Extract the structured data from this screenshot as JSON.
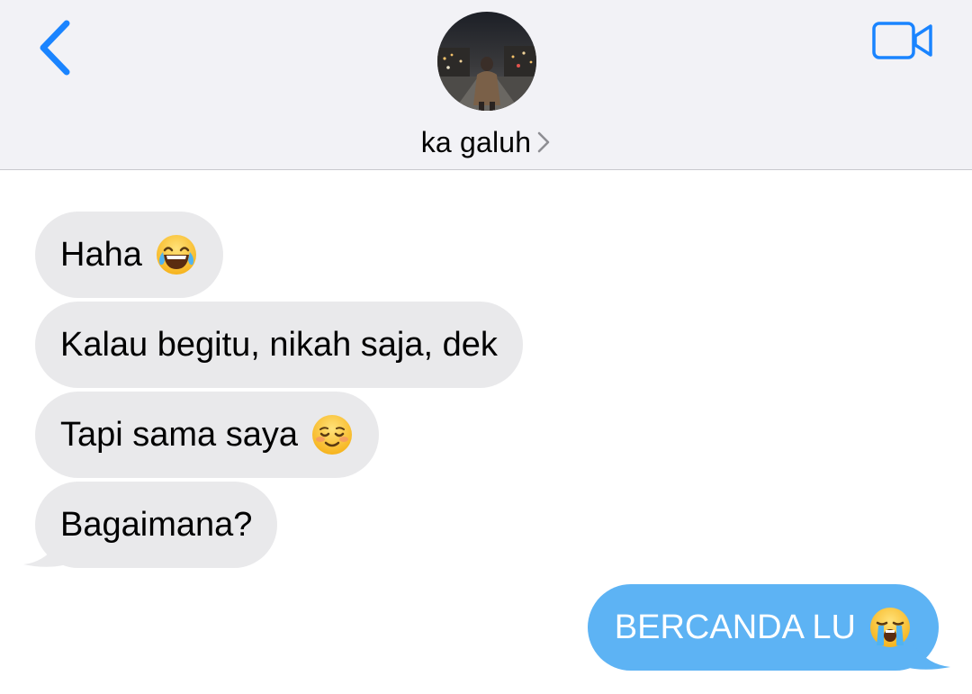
{
  "header": {
    "contact_name": "ka galuh",
    "icons": {
      "back": "chevron-left-icon",
      "video": "video-camera-icon",
      "contact_chevron": "chevron-right-icon"
    }
  },
  "messages": [
    {
      "direction": "incoming",
      "text": "Haha",
      "emoji": "face-with-tears-of-joy"
    },
    {
      "direction": "incoming",
      "text": "Kalau begitu, nikah saja, dek",
      "emoji": ""
    },
    {
      "direction": "incoming",
      "text": "Tapi sama saya",
      "emoji": "smiling-face"
    },
    {
      "direction": "incoming",
      "text": "Bagaimana?",
      "emoji": ""
    },
    {
      "direction": "outgoing",
      "text": "BERCANDA LU",
      "emoji": "loudly-crying-face"
    }
  ],
  "colors": {
    "accent": "#1a84ff",
    "incoming_bubble": "#e9e9eb",
    "outgoing_bubble": "#5db3f4",
    "header_bg": "#f2f2f6"
  }
}
